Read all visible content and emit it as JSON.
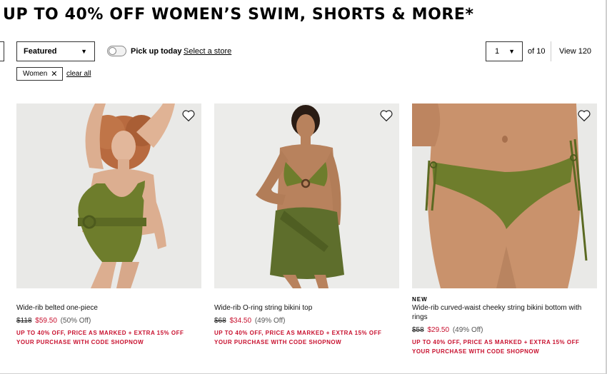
{
  "banner": {
    "headline": "UP TO 40% OFF WOMEN’S SWIM, SHORTS & MORE*"
  },
  "toolbar": {
    "sort": {
      "selected": "Featured"
    },
    "pickup": {
      "label": "Pick up today",
      "enabled": false,
      "store_link": "Select a store"
    },
    "pagination": {
      "current_page": "1",
      "total_label": "of 10",
      "view_label": "View 120"
    }
  },
  "filters": {
    "chips": [
      {
        "label": "Women"
      }
    ],
    "clear_all": "clear all"
  },
  "products": [
    {
      "badge": "",
      "name": "Wide-rib belted one-piece",
      "original_price": "$118",
      "sale_price": "$59.50",
      "discount": "(50% Off)",
      "promo": "UP TO 40% OFF, PRICE AS MARKED + EXTRA 15% OFF YOUR PURCHASE WITH CODE SHOPNOW"
    },
    {
      "badge": "",
      "name": "Wide-rib O-ring string bikini top",
      "original_price": "$68",
      "sale_price": "$34.50",
      "discount": "(49% Off)",
      "promo": "UP TO 40% OFF, PRICE AS MARKED + EXTRA 15% OFF YOUR PURCHASE WITH CODE SHOPNOW"
    },
    {
      "badge": "NEW",
      "name": "Wide-rib curved-waist cheeky string bikini bottom with rings",
      "original_price": "$58",
      "sale_price": "$29.50",
      "discount": "(49% Off)",
      "promo": "UP TO 40% OFF, PRICE AS MARKED + EXTRA 15% OFF YOUR PURCHASE WITH CODE SHOPNOW"
    }
  ],
  "colors": {
    "sale_red": "#c8102e",
    "swim_green": "#6e7d2c",
    "backdrop": "#e9e9e7"
  },
  "icons": {
    "wishlist": "heart-outline-icon",
    "remove_filter": "close-icon",
    "dropdown": "caret-down-icon"
  }
}
